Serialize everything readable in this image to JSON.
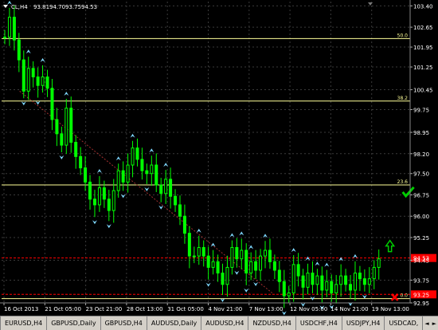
{
  "chart_data": {
    "type": "candlestick",
    "symbol_header": "CL,H4",
    "ohlc_values": [
      "93.81",
      "94.70",
      "93.75",
      "94.53"
    ],
    "ylim": [
      92.95,
      103.55
    ],
    "y_ticks": [
      "103.40",
      "102.65",
      "101.95",
      "101.25",
      "100.45",
      "99.75",
      "98.95",
      "98.20",
      "97.50",
      "96.75",
      "96.00",
      "95.25",
      "94.45",
      "93.75",
      "92.95"
    ],
    "x_labels": [
      "16 Oct 2013",
      "21 Oct 05:00",
      "23 Oct 21:00",
      "28 Oct 13:00",
      "31 Oct 05:00",
      "4 Nov 21:00",
      "7 Nov 13:00",
      "12 Nov 05:00",
      "14 Nov 21:00",
      "19 Nov 13:00"
    ],
    "fib_levels": [
      {
        "label": "50.0",
        "price": 102.25
      },
      {
        "label": "38.2",
        "price": 100.05
      },
      {
        "label": "23.6",
        "price": 97.1
      },
      {
        "label": "0.0",
        "price": 93.1
      }
    ],
    "price_lines": [
      {
        "label": "94.53",
        "price": 94.53,
        "color": "#ff0000"
      },
      {
        "label": "93.25",
        "price": 93.25,
        "color": "#ff0000"
      }
    ],
    "close_path": [
      [
        0,
        102.3
      ],
      [
        1,
        103.0
      ],
      [
        2,
        102.2
      ],
      [
        3,
        101.5
      ],
      [
        4,
        100.4
      ],
      [
        5,
        101.2
      ],
      [
        6,
        100.9
      ],
      [
        7,
        100.6
      ],
      [
        8,
        100.9
      ],
      [
        9,
        100.5
      ],
      [
        10,
        99.4
      ],
      [
        11,
        98.9
      ],
      [
        12,
        98.5
      ],
      [
        13,
        99.8
      ],
      [
        14,
        98.6
      ],
      [
        15,
        98.1
      ],
      [
        16,
        97.7
      ],
      [
        17,
        97.2
      ],
      [
        18,
        96.6
      ],
      [
        19,
        96.4
      ],
      [
        20,
        97.0
      ],
      [
        21,
        96.6
      ],
      [
        22,
        96.2
      ],
      [
        23,
        96.9
      ],
      [
        24,
        97.6
      ],
      [
        25,
        97.2
      ],
      [
        26,
        97.8
      ],
      [
        27,
        98.4
      ],
      [
        28,
        98.0
      ],
      [
        29,
        97.6
      ],
      [
        30,
        97.5
      ],
      [
        31,
        97.8
      ],
      [
        32,
        97.1
      ],
      [
        33,
        96.8
      ],
      [
        34,
        97.3
      ],
      [
        35,
        96.7
      ],
      [
        36,
        96.4
      ],
      [
        37,
        96.0
      ],
      [
        38,
        95.4
      ],
      [
        39,
        94.6
      ],
      [
        40,
        94.6
      ],
      [
        41,
        94.9
      ],
      [
        42,
        94.6
      ],
      [
        43,
        94.2
      ],
      [
        44,
        94.4
      ],
      [
        45,
        94.0
      ],
      [
        46,
        93.6
      ],
      [
        47,
        94.2
      ],
      [
        48,
        94.9
      ],
      [
        49,
        94.5
      ],
      [
        50,
        94.8
      ],
      [
        51,
        94.0
      ],
      [
        52,
        94.4
      ],
      [
        53,
        94.1
      ],
      [
        54,
        94.6
      ],
      [
        55,
        94.8
      ],
      [
        56,
        94.4
      ],
      [
        57,
        94.1
      ],
      [
        58,
        93.7
      ],
      [
        59,
        93.2
      ],
      [
        60,
        93.3
      ],
      [
        61,
        94.3
      ],
      [
        62,
        93.9
      ],
      [
        63,
        93.5
      ],
      [
        64,
        94.0
      ],
      [
        65,
        93.6
      ],
      [
        66,
        93.9
      ],
      [
        67,
        93.4
      ],
      [
        68,
        93.7
      ],
      [
        69,
        93.3
      ],
      [
        70,
        93.6
      ],
      [
        71,
        93.9
      ],
      [
        72,
        93.6
      ],
      [
        73,
        93.4
      ],
      [
        74,
        94.0
      ],
      [
        75,
        93.8
      ],
      [
        76,
        93.6
      ],
      [
        77,
        93.8
      ],
      [
        78,
        94.2
      ],
      [
        79,
        94.5
      ]
    ],
    "direction_markers": [
      {
        "type": "up-arrow",
        "price": 94.95,
        "color": "#00cc00"
      },
      {
        "type": "check",
        "price": 96.85,
        "color": "#00cc00"
      },
      {
        "type": "cross",
        "price": 93.15,
        "color": "#ff0000"
      }
    ],
    "grid": true,
    "background": "#000000",
    "candle_color": "#00ff00",
    "grid_color": "#3a3a3a",
    "fib_color": "#ffff99"
  },
  "tabs": [
    "EURUSD,H4",
    "GBPUSD,Daily",
    "GBPUSD,H4",
    "AUDUSD,Daily",
    "AUDUSD,H4",
    "NZDUSD,H4",
    "USDCHF,H4",
    "USDJPY,H4",
    "USDCAD,"
  ],
  "tab_nav": {
    "left": "◄",
    "right": "►"
  }
}
